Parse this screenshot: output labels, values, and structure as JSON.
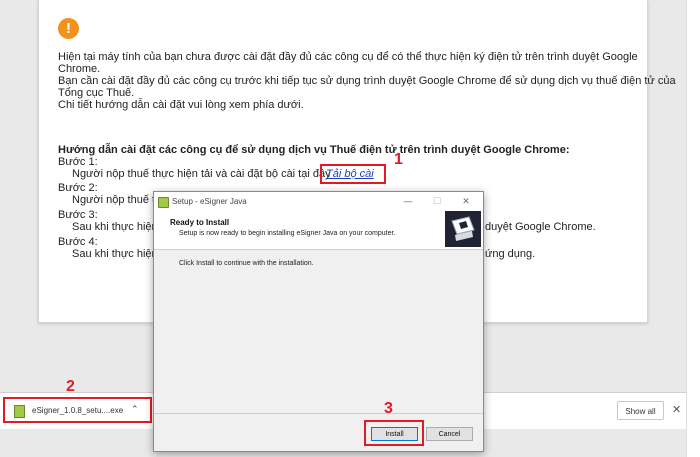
{
  "page": {
    "para1_l1": "Hiện tại máy tính của bạn chưa được cài đặt đầy đủ các công cụ để có thể thực hiện ký điện tử trên trình duyệt Google",
    "para1_l2": "Chrome.",
    "para2_l1": "Bạn cần cài đặt đầy đủ các công cụ trước khi tiếp tục sử dụng trình duyệt Google Chrome để sử dụng dịch vụ thuế điện tử của",
    "para2_l2": "Tổng cục Thuế.",
    "para3": "Chi tiết hướng dẫn cài đặt vui lòng xem phía dưới.",
    "guide_title": "Hướng dẫn cài đặt các công cụ để sử dụng dịch vụ Thuế điện tử trên trình duyệt Google Chrome:",
    "steps": [
      {
        "label": "Bước 1:",
        "text": "Người nộp thuế thực hiện tải và cài đặt bộ cài tại đây",
        "link": "Tải bộ cài"
      },
      {
        "label": "Bước 2:",
        "text": "Người nộp thuế th"
      },
      {
        "label": "Bước 3:",
        "text": "Sau khi thực hiện",
        "tail": "duyệt Google Chrome."
      },
      {
        "label": "Bước 4:",
        "text": "Sau khi thực hiện",
        "tail": "ứng dụng."
      }
    ]
  },
  "annotations": {
    "num1": "1",
    "num2": "2",
    "num3": "3"
  },
  "dialog": {
    "title": "Setup - eSigner Java",
    "minimize": "—",
    "maximize": "☐",
    "close": "✕",
    "header_title": "Ready to Install",
    "header_subtitle": "Setup is now ready to begin installing eSigner Java on your computer.",
    "body_text": "Click Install to continue with the installation.",
    "install_label": "Install",
    "cancel_label": "Cancel"
  },
  "download_bar": {
    "file_name": "eSigner_1.0.8_setu....exe",
    "chevron": "⌃",
    "show_all": "Show all",
    "close": "✕"
  },
  "colors": {
    "accent_red": "#e01b24",
    "link": "#1a3fc7",
    "warning": "#f2921d"
  }
}
